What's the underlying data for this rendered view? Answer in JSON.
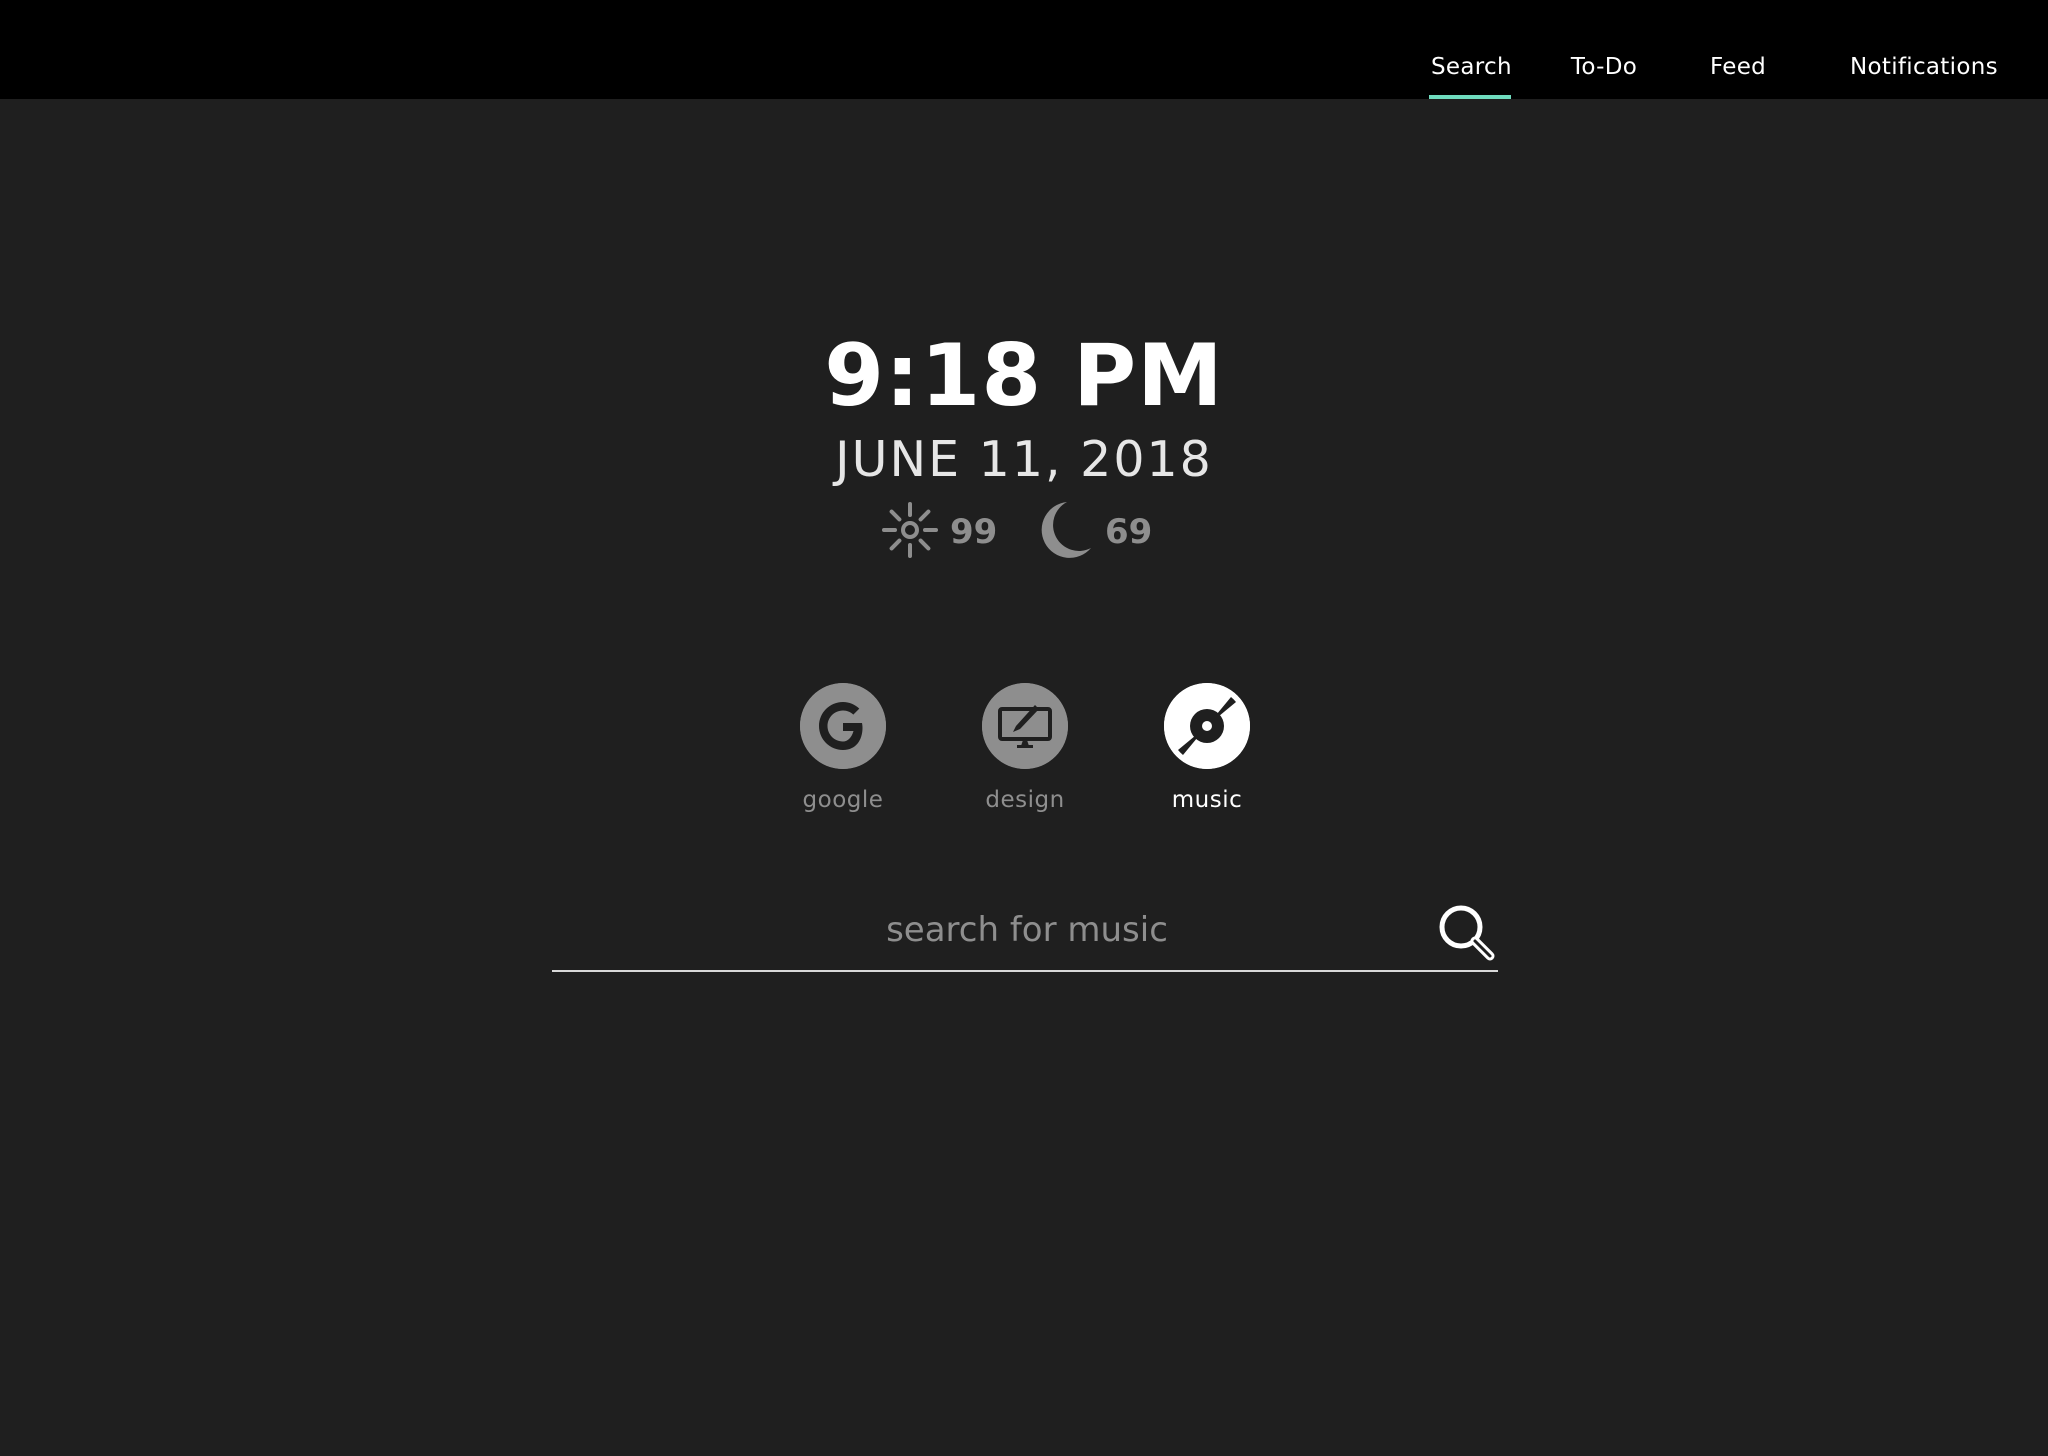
{
  "nav": {
    "tabs": [
      {
        "label": "Search",
        "active": true
      },
      {
        "label": "To-Do",
        "active": false
      },
      {
        "label": "Feed",
        "active": false
      },
      {
        "label": "Notifications",
        "active": false
      }
    ],
    "accent_color": "#6fdcbe"
  },
  "clock": {
    "time": "9:18 PM",
    "date": "JUNE 11, 2018"
  },
  "weather": {
    "high": {
      "icon": "sun-icon",
      "value": "99"
    },
    "low": {
      "icon": "moon-icon",
      "value": "69"
    }
  },
  "engines": [
    {
      "label": "google",
      "icon": "google-icon",
      "active": false
    },
    {
      "label": "design",
      "icon": "design-monitor-icon",
      "active": false
    },
    {
      "label": "music",
      "icon": "music-record-icon",
      "active": true
    }
  ],
  "search": {
    "placeholder": "search for music",
    "value": "",
    "button_icon": "search-icon"
  },
  "colors": {
    "background": "#1f1f1f",
    "topbar": "#000000",
    "muted": "#8e8e8e"
  }
}
